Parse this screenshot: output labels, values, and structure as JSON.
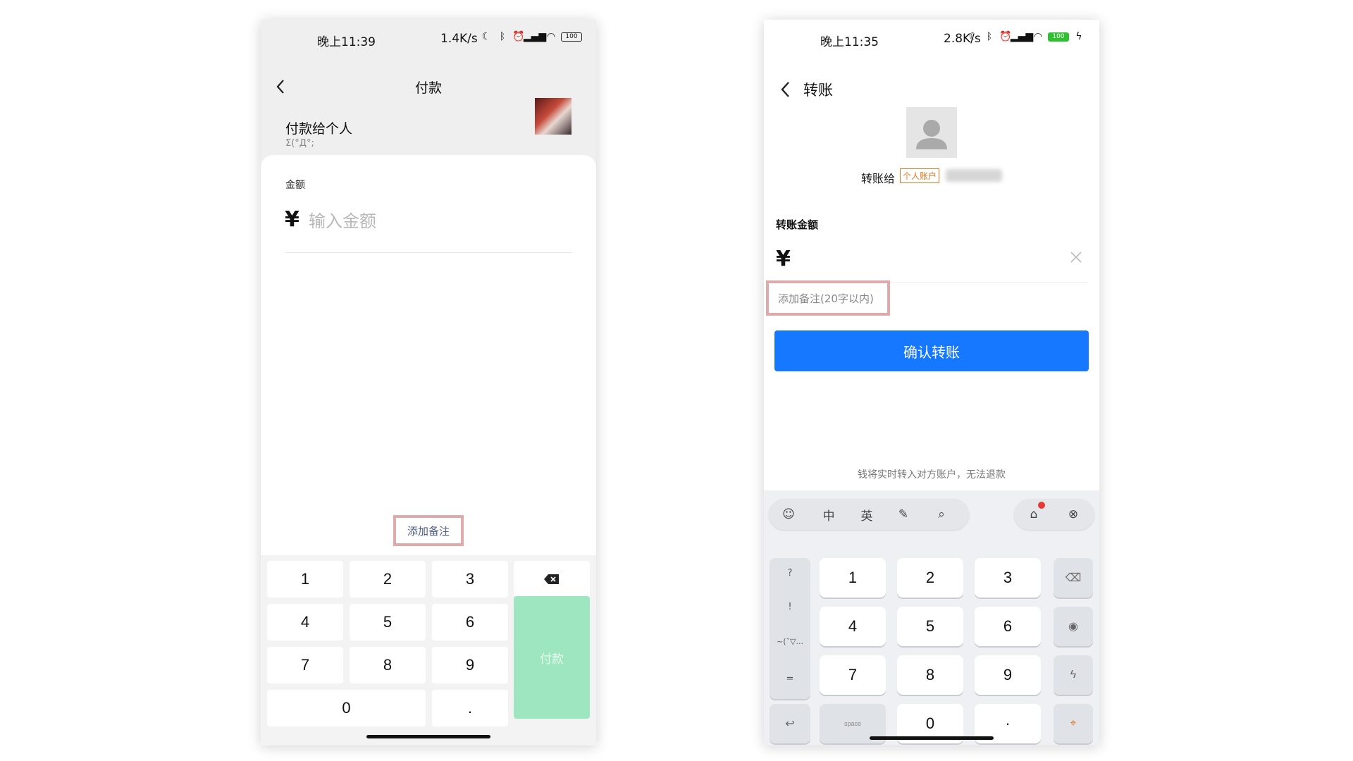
{
  "left": {
    "status": {
      "time": "晚上11:39",
      "net": "1.4K/s",
      "battery": "100"
    },
    "header": {
      "title": "付款"
    },
    "payee": {
      "title": "付款给个人",
      "name": "Σ(°Д°;"
    },
    "amount": {
      "label": "金额",
      "currency": "¥",
      "placeholder": "输入金额"
    },
    "note_link": "添加备注",
    "keypad": {
      "keys": [
        "1",
        "2",
        "3",
        "4",
        "5",
        "6",
        "7",
        "8",
        "9",
        "0",
        "."
      ],
      "pay_label": "付款"
    },
    "colors": {
      "pay_button": "#9ee6c0",
      "note_text": "#4f5f85"
    }
  },
  "right": {
    "status": {
      "time": "晚上11:35",
      "net": "2.8K/s",
      "battery": "100"
    },
    "header": {
      "title": "转账"
    },
    "recipient": {
      "prefix": "转账给",
      "badge": "个人账户"
    },
    "amount": {
      "label": "转账金额",
      "currency": "¥"
    },
    "note_placeholder": "添加备注(20字以内)",
    "confirm_label": "确认转账",
    "hint": "钱将实时转入对方账户，无法退款",
    "keyboard": {
      "toolbar": {
        "cn": "中",
        "en": "英"
      },
      "side_symbols": [
        "?",
        "!",
        "~(ˇ▽...",
        "="
      ],
      "digits": [
        "1",
        "2",
        "3",
        "4",
        "5",
        "6",
        "7",
        "8",
        "9",
        "0"
      ],
      "dot": "·",
      "space": "space"
    },
    "colors": {
      "confirm_button": "#1677ff",
      "badge": "#e4761e"
    }
  },
  "highlight_color": "#dfaaaa"
}
